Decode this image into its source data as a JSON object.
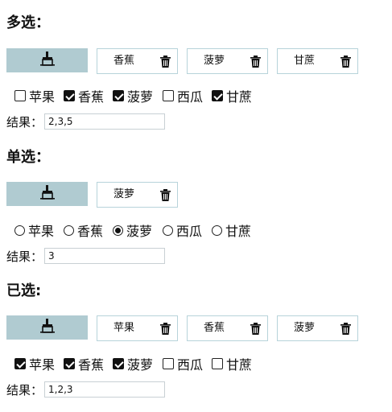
{
  "multi": {
    "title": "多选：",
    "tags": [
      "香蕉",
      "菠萝",
      "甘蔗"
    ],
    "options": [
      {
        "label": "苹果",
        "checked": false
      },
      {
        "label": "香蕉",
        "checked": true
      },
      {
        "label": "菠萝",
        "checked": true
      },
      {
        "label": "西瓜",
        "checked": false
      },
      {
        "label": "甘蔗",
        "checked": true
      }
    ],
    "result_label": "结果：",
    "result_value": "2,3,5"
  },
  "single": {
    "title": "单选：",
    "tags": [
      "菠萝"
    ],
    "options": [
      {
        "label": "苹果",
        "checked": false
      },
      {
        "label": "香蕉",
        "checked": false
      },
      {
        "label": "菠萝",
        "checked": true
      },
      {
        "label": "西瓜",
        "checked": false
      },
      {
        "label": "甘蔗",
        "checked": false
      }
    ],
    "result_label": "结果：",
    "result_value": "3"
  },
  "selected": {
    "title": "已选:",
    "tags": [
      "苹果",
      "香蕉",
      "菠萝"
    ],
    "options": [
      {
        "label": "苹果",
        "checked": true
      },
      {
        "label": "香蕉",
        "checked": true
      },
      {
        "label": "菠萝",
        "checked": true
      },
      {
        "label": "西瓜",
        "checked": false
      },
      {
        "label": "甘蔗",
        "checked": false
      }
    ],
    "result_label": "结果：",
    "result_value": "1,2,3"
  },
  "icons": {
    "clear": "broom-icon",
    "delete": "trash-icon"
  },
  "colors": {
    "accent": "#b0cbd1",
    "tag_border": "#b7d3da"
  }
}
